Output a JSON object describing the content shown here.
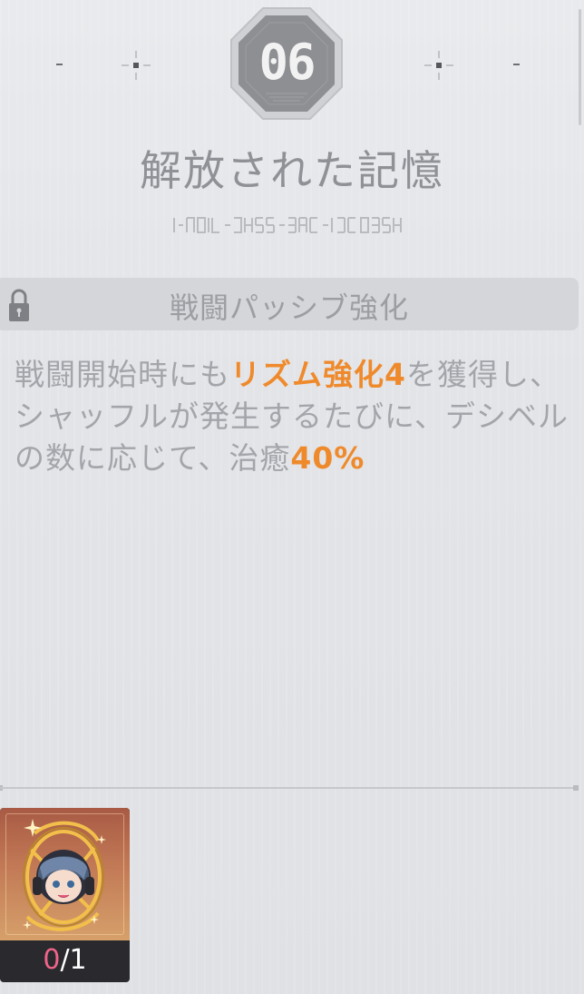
{
  "badge": {
    "number": "06"
  },
  "title": "解放された記憶",
  "skill": {
    "name": "戦闘パッシブ強化",
    "locked": true
  },
  "description": {
    "p1": "戦闘開始時にも",
    "h1": "リズム強化4",
    "p2": "を獲得し、シャッフルが発生するたびに、デシベルの数に応じて、治癒",
    "h2": "40%"
  },
  "item": {
    "owned": "0",
    "separator": "/",
    "required": "1"
  },
  "colors": {
    "highlight": "#ef8a2c",
    "count_zero": "#f0648a",
    "badge": "#8d8f93"
  },
  "icons": {
    "lock": "lock-icon",
    "crosshair": "crosshair-icon",
    "portrait": "character-portrait-icon"
  }
}
